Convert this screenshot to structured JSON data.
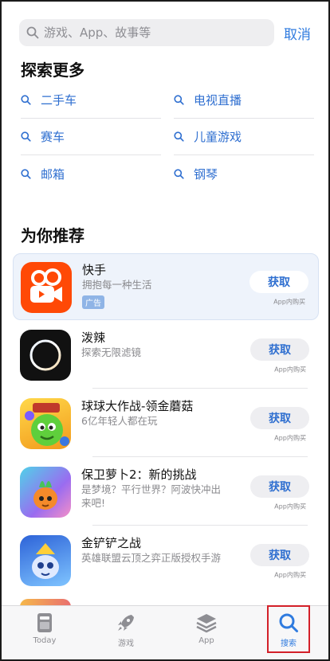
{
  "search": {
    "placeholder": "游戏、App、故事等",
    "cancel_label": "取消"
  },
  "explore": {
    "title": "探索更多",
    "items": [
      {
        "label": "二手车",
        "icon": "search-icon"
      },
      {
        "label": "电视直播",
        "icon": "search-icon"
      },
      {
        "label": "赛车",
        "icon": "search-icon"
      },
      {
        "label": "儿童游戏",
        "icon": "search-icon"
      },
      {
        "label": "邮箱",
        "icon": "search-icon"
      },
      {
        "label": "钢琴",
        "icon": "search-icon"
      }
    ]
  },
  "recommend": {
    "title": "为你推荐",
    "apps": [
      {
        "name": "快手",
        "subtitle": "拥抱每一种生活",
        "badge": "广告",
        "button": "获取",
        "iap": "App内购买",
        "icon": "kuaishou-app-icon"
      },
      {
        "name": "泼辣",
        "subtitle": "探索无限滤镜",
        "button": "获取",
        "iap": "App内购买",
        "icon": "polarr-app-icon"
      },
      {
        "name": "球球大作战-领金蘑菇",
        "subtitle": "6亿年轻人都在玩",
        "button": "获取",
        "iap": "App内购买",
        "icon": "battle-of-balls-app-icon"
      },
      {
        "name": "保卫萝卜2：新的挑战",
        "subtitle": "是梦境？平行世界？阿波快冲出来吧!",
        "button": "获取",
        "iap": "App内购买",
        "icon": "carrot-fantasy-app-icon"
      },
      {
        "name": "金铲铲之战",
        "subtitle": "英雄联盟云顶之弈正版授权手游",
        "button": "获取",
        "iap": "App内购买",
        "icon": "golden-spatula-app-icon"
      }
    ]
  },
  "tabbar": {
    "tabs": [
      {
        "label": "Today",
        "icon": "today-icon"
      },
      {
        "label": "游戏",
        "icon": "rocket-icon"
      },
      {
        "label": "App",
        "icon": "apps-stack-icon"
      },
      {
        "label": "搜索",
        "icon": "search-icon",
        "active": true
      }
    ]
  },
  "colors": {
    "accent": "#2f7bdf",
    "highlight_border": "#d32029",
    "ad_background": "#eef3fb"
  }
}
